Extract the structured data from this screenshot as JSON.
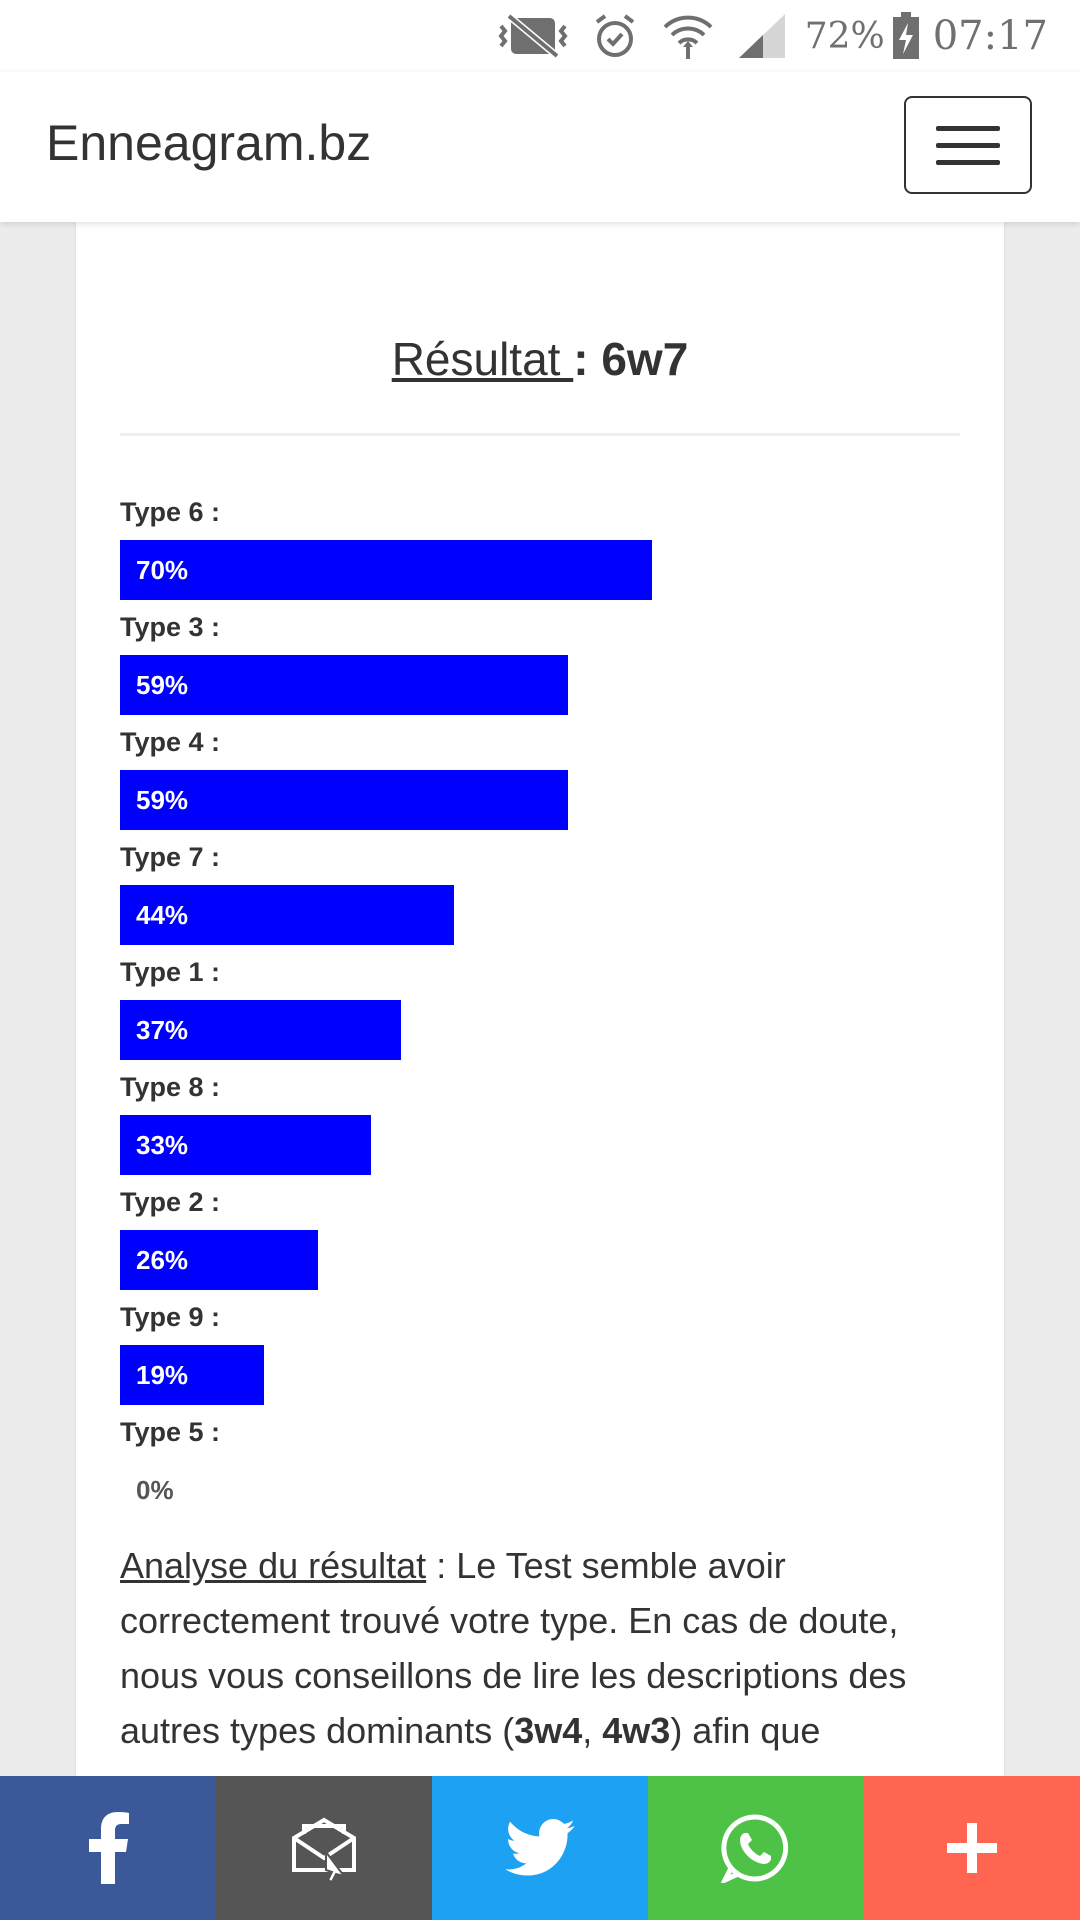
{
  "status_bar": {
    "battery_percent": "72%",
    "time": "07:17"
  },
  "navbar": {
    "brand": "Enneagram.bz"
  },
  "result": {
    "label": "Résultat ",
    "separator": ": ",
    "value": "6w7"
  },
  "chart_data": {
    "type": "bar",
    "categories": [
      "Type 6 :",
      "Type 3 :",
      "Type 4 :",
      "Type 7 :",
      "Type 1 :",
      "Type 8 :",
      "Type 2 :",
      "Type 9 :",
      "Type 5 :"
    ],
    "values": [
      70,
      59,
      59,
      44,
      37,
      33,
      26,
      19,
      0
    ],
    "value_labels": [
      "70%",
      "59%",
      "59%",
      "44%",
      "37%",
      "33%",
      "26%",
      "19%",
      "0%"
    ],
    "ylim": [
      0,
      100
    ],
    "bar_color": "#0000ff"
  },
  "analysis": {
    "heading": "Analyse du résultat",
    "text_1": " : Le Test semble avoir correctement trouvé votre type. En cas de doute, nous vous conseillons de lire les descriptions des autres types dominants (",
    "type_a": "3w4",
    "comma": ", ",
    "type_b": "4w3",
    "text_2": ") afin que"
  },
  "share_bar": {
    "buttons": [
      {
        "name": "facebook",
        "icon": "facebook-icon",
        "color": "#3b5998"
      },
      {
        "name": "email",
        "icon": "email-icon",
        "color": "#555555"
      },
      {
        "name": "twitter",
        "icon": "twitter-icon",
        "color": "#1da1f2"
      },
      {
        "name": "whatsapp",
        "icon": "whatsapp-icon",
        "color": "#4dc247"
      },
      {
        "name": "more",
        "icon": "plus-icon",
        "color": "#ff6550"
      }
    ]
  }
}
